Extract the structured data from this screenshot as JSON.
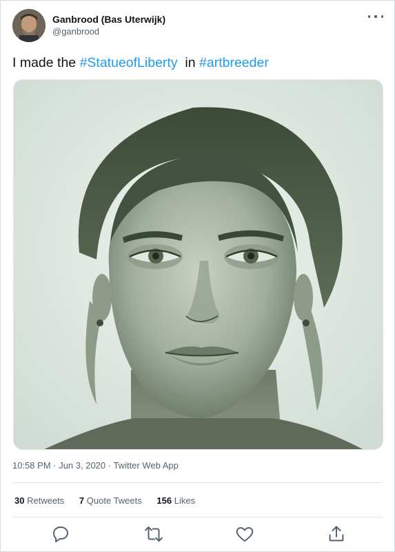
{
  "tweet": {
    "author": {
      "name": "Ganbrood (Bas Uterwijk)",
      "handle": "@ganbrood"
    },
    "text": {
      "prefix": "I made the ",
      "hashtag_1": "#StatueofLiberty",
      "middle": "  in ",
      "hashtag_2": "#artbreeder"
    },
    "media": {
      "description": ""
    },
    "meta": {
      "timestamp": "10:58 PM · Jun 3, 2020 · Twitter Web App"
    },
    "stats": {
      "retweets": {
        "count": "30",
        "label": "Retweets"
      },
      "quote_tweets": {
        "count": "7",
        "label": "Quote Tweets"
      },
      "likes": {
        "count": "156",
        "label": "Likes"
      }
    }
  },
  "icons": {
    "more": "more-icon",
    "reply": "reply-icon",
    "retweet": "retweet-icon",
    "like": "heart-icon",
    "share": "share-icon"
  },
  "colors": {
    "hashtag": "#1d9bf0",
    "secondary_text": "#536471",
    "primary_text": "#0f1419",
    "divider": "#e1e8ed"
  }
}
